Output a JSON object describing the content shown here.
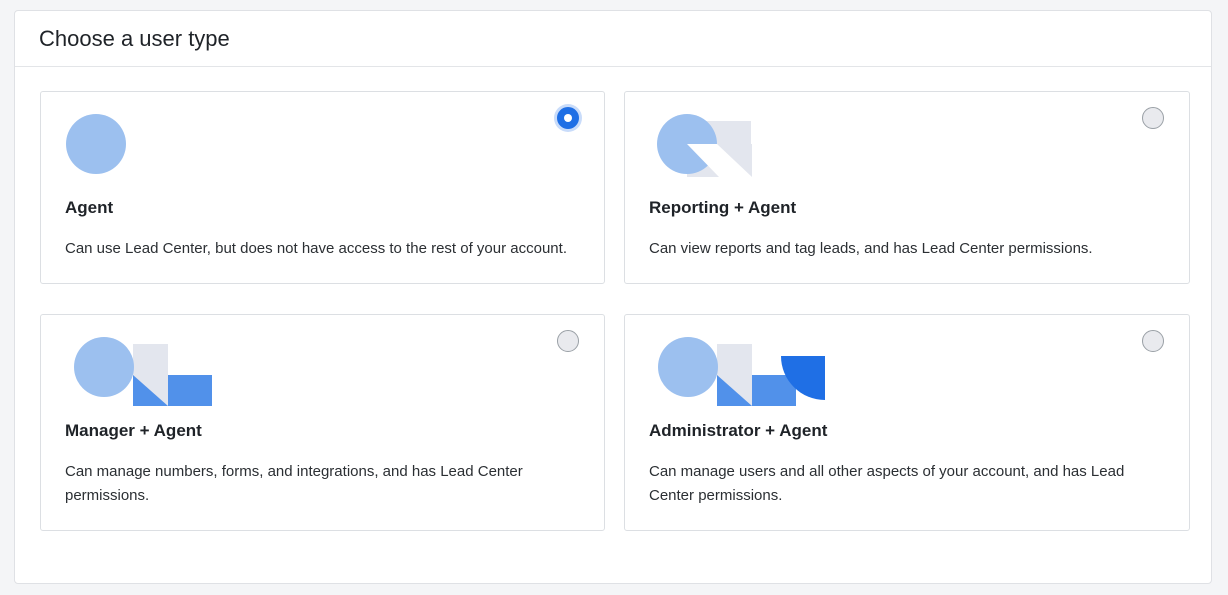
{
  "page": {
    "title": "Choose a user type"
  },
  "colors": {
    "circle": "#9cc0ef",
    "gray_shape": "#e3e6ee",
    "blue_rect": "#5191ea",
    "dark_blue": "#1f6fe5",
    "selected_radio": "#1f6fe5"
  },
  "user_types": [
    {
      "title": "Agent",
      "description": "Can use Lead Center, but does not have access to the rest of your account.",
      "selected": true,
      "icon": "agent-illustration-icon"
    },
    {
      "title": "Reporting + Agent",
      "description": "Can view reports and tag leads, and has Lead Center permissions.",
      "selected": false,
      "icon": "reporting-agent-illustration-icon"
    },
    {
      "title": "Manager + Agent",
      "description": "Can manage numbers, forms, and integrations, and has Lead Center permissions.",
      "selected": false,
      "icon": "manager-agent-illustration-icon"
    },
    {
      "title": "Administrator + Agent",
      "description": "Can manage users and all other aspects of your account, and has Lead Center permissions.",
      "selected": false,
      "icon": "administrator-agent-illustration-icon"
    }
  ]
}
